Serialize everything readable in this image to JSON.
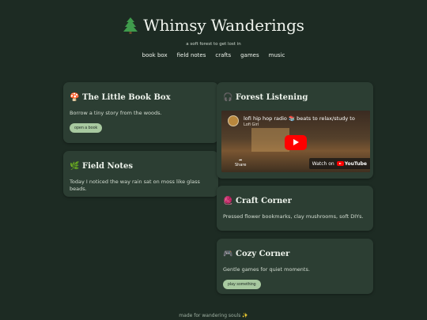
{
  "site": {
    "title": "Whimsy Wanderings",
    "title_icon": "tree-icon",
    "tagline": "a soft forest to get lost in"
  },
  "nav": [
    "book box",
    "field notes",
    "crafts",
    "games",
    "music"
  ],
  "cards": {
    "book_box": {
      "icon": "mushroom-icon",
      "emoji": "🍄",
      "title": "The Little Book Box",
      "text": "Borrow a tiny story from the woods.",
      "button": "open a book"
    },
    "field_notes": {
      "icon": "herb-icon",
      "emoji": "🌿",
      "title": "Field Notes",
      "text": "Today I noticed the way rain sat on moss like glass beads."
    },
    "forest_listening": {
      "icon": "headphones-icon",
      "emoji": "🎧",
      "title": "Forest Listening",
      "video": {
        "title": "lofi hip hop radio 📚 beats to relax/study to",
        "channel": "Lofi Girl",
        "share_label": "Share",
        "watch_label": "Watch on",
        "platform": "YouTube"
      }
    },
    "craft_corner": {
      "icon": "yarn-icon",
      "emoji": "🧶",
      "title": "Craft Corner",
      "text": "Pressed flower bookmarks, clay mushrooms, soft DIYs."
    },
    "cozy_corner": {
      "icon": "gamepad-icon",
      "emoji": "🎮",
      "title": "Cozy Corner",
      "text": "Gentle games for quiet moments.",
      "button": "play something"
    }
  },
  "footer": "made for wandering souls ✨",
  "colors": {
    "background": "#1d2b23",
    "card": "#2c3e33",
    "button": "#a8c9a0",
    "text": "#e3ebe2"
  }
}
